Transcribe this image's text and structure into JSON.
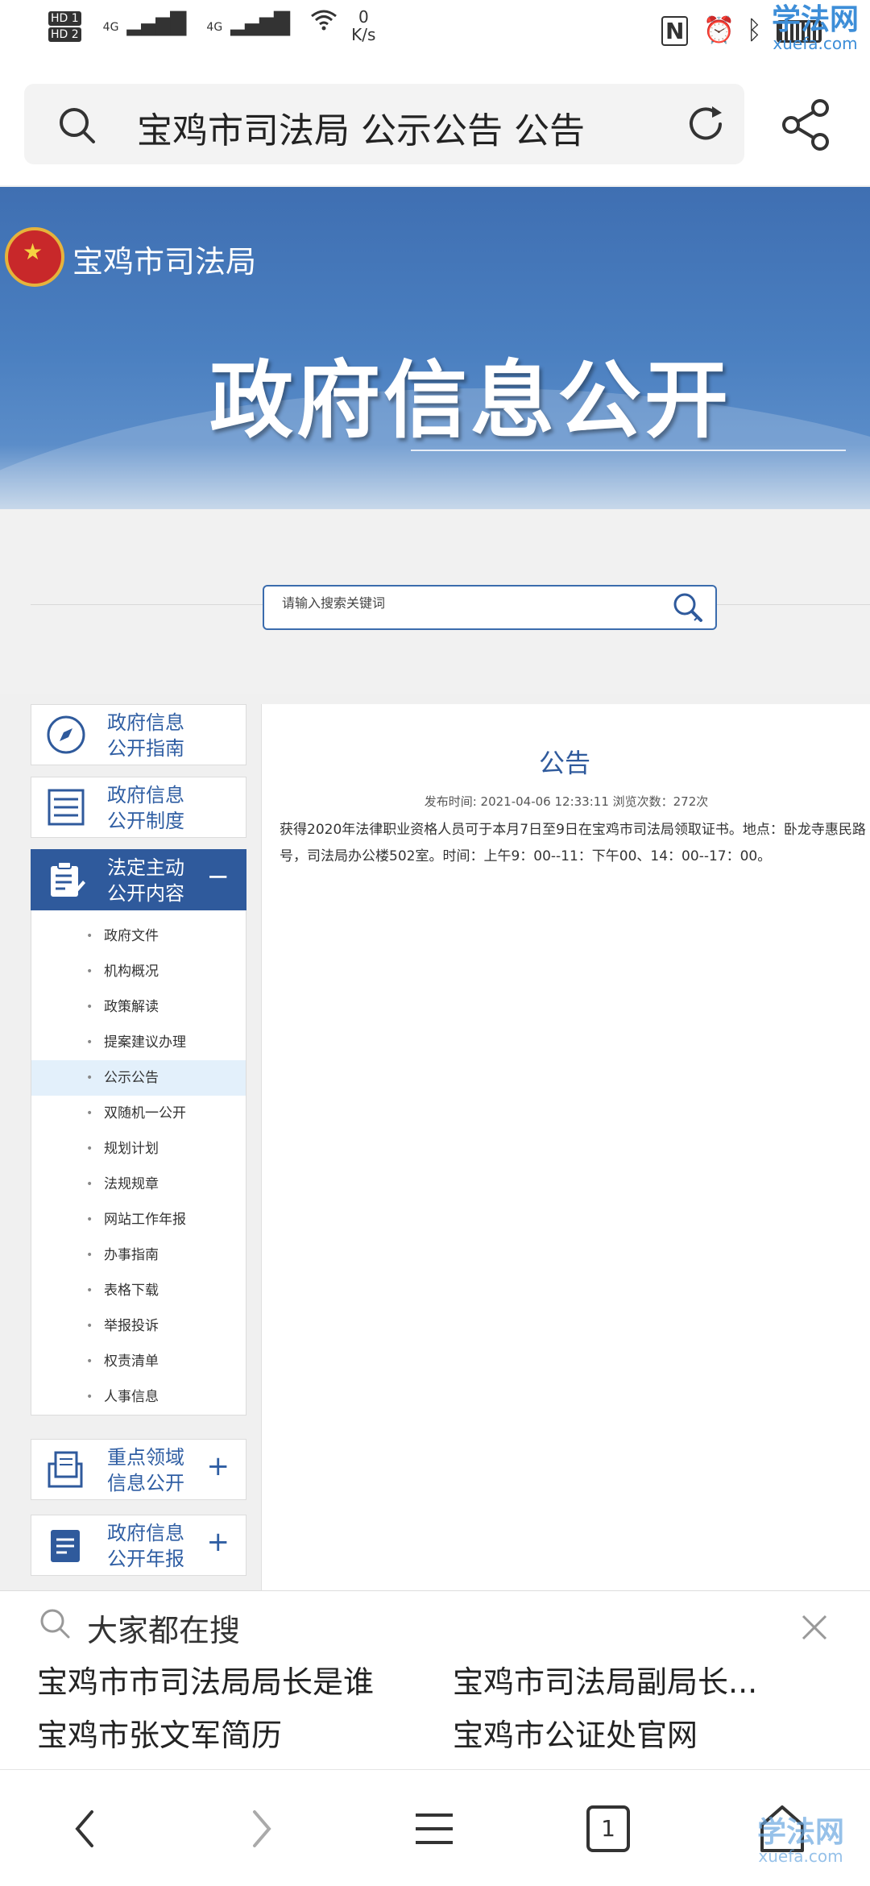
{
  "status_bar": {
    "network_left": [
      "HD 1",
      "HD 2",
      "4G",
      "4G"
    ],
    "speed_value": "0",
    "speed_unit": "K/s"
  },
  "watermark": {
    "cn": "学法网",
    "en": "xuefa.com"
  },
  "address_bar": {
    "query": "宝鸡市司法局 公示公告 公告"
  },
  "site": {
    "name": "宝鸡市司法局",
    "banner_title": "政府信息公开",
    "search_placeholder": "请输入搜索关键词"
  },
  "sidebar": {
    "cards": [
      {
        "line1": "政府信息",
        "line2": "公开指南",
        "toggle": ""
      },
      {
        "line1": "政府信息",
        "line2": "公开制度",
        "toggle": ""
      },
      {
        "line1": "法定主动",
        "line2": "公开内容",
        "toggle": "−"
      },
      {
        "line1": "重点领域",
        "line2": "信息公开",
        "toggle": "+"
      },
      {
        "line1": "政府信息",
        "line2": "公开年报",
        "toggle": "+"
      }
    ],
    "submenu": [
      "政府文件",
      "机构概况",
      "政策解读",
      "提案建议办理",
      "公示公告",
      "双随机一公开",
      "规划计划",
      "法规规章",
      "网站工作年报",
      "办事指南",
      "表格下载",
      "举报投诉",
      "权责清单",
      "人事信息"
    ],
    "selected": "公示公告"
  },
  "article": {
    "title": "公告",
    "meta": "发布时间: 2021-04-06 12:33:11 浏览次数：272次",
    "line1": "获得2020年法律职业资格人员可于本月7日至9日在宝鸡市司法局领取证书。地点：卧龙寺惠民路",
    "line2": "号，司法局办公楼502室。时间：上午9：00--11：下午00、14：00--17：00。"
  },
  "suggestions": {
    "title": "大家都在搜",
    "items": [
      "宝鸡市市司法局局长是谁",
      "宝鸡市司法局副局长...",
      "宝鸡市张文军简历",
      "宝鸡市公证处官网"
    ]
  },
  "nav": {
    "tab_count": "1"
  },
  "colors": {
    "accent": "#2f5a9c",
    "banner": "#4a7fc0",
    "selected_bg": "#e3f0fb"
  }
}
